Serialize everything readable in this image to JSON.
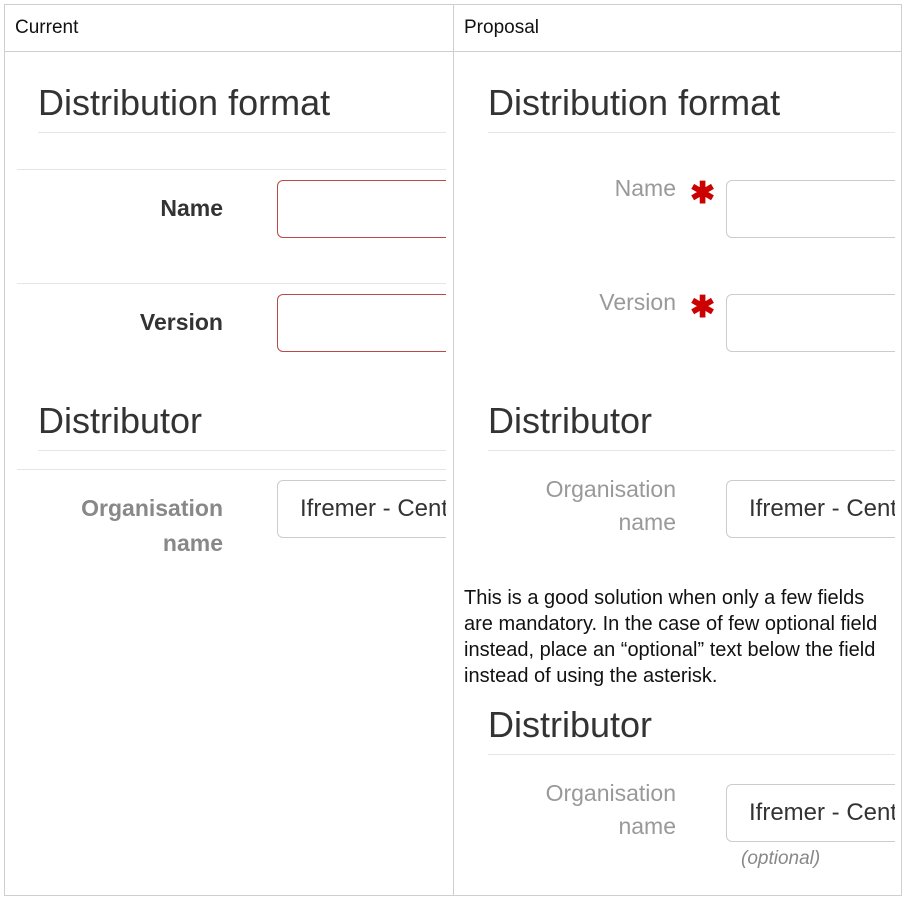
{
  "columns": {
    "current": "Current",
    "proposal": "Proposal"
  },
  "current": {
    "section1_title": "Distribution format",
    "name_label": "Name",
    "version_label": "Version",
    "section2_title": "Distributor",
    "org_label_line1": "Organisation",
    "org_label_line2": "name",
    "org_value": "Ifremer - Centre"
  },
  "proposal": {
    "section1_title": "Distribution format",
    "name_label": "Name",
    "version_label": "Version",
    "required_marker": "✱",
    "section2_title": "Distributor",
    "org_label_line1": "Organisation",
    "org_label_line2": "name",
    "org_value": "Ifremer - Centre",
    "note": "This is a good solution when only a few fields are mandatory. In the case of few optional field instead, place an “optional” text below the field instead of using the asterisk.",
    "section3_title": "Distributor",
    "org2_label_line1": "Organisation",
    "org2_label_line2": "name",
    "org2_value": "Ifremer - Centre",
    "optional_hint": "(optional)"
  }
}
